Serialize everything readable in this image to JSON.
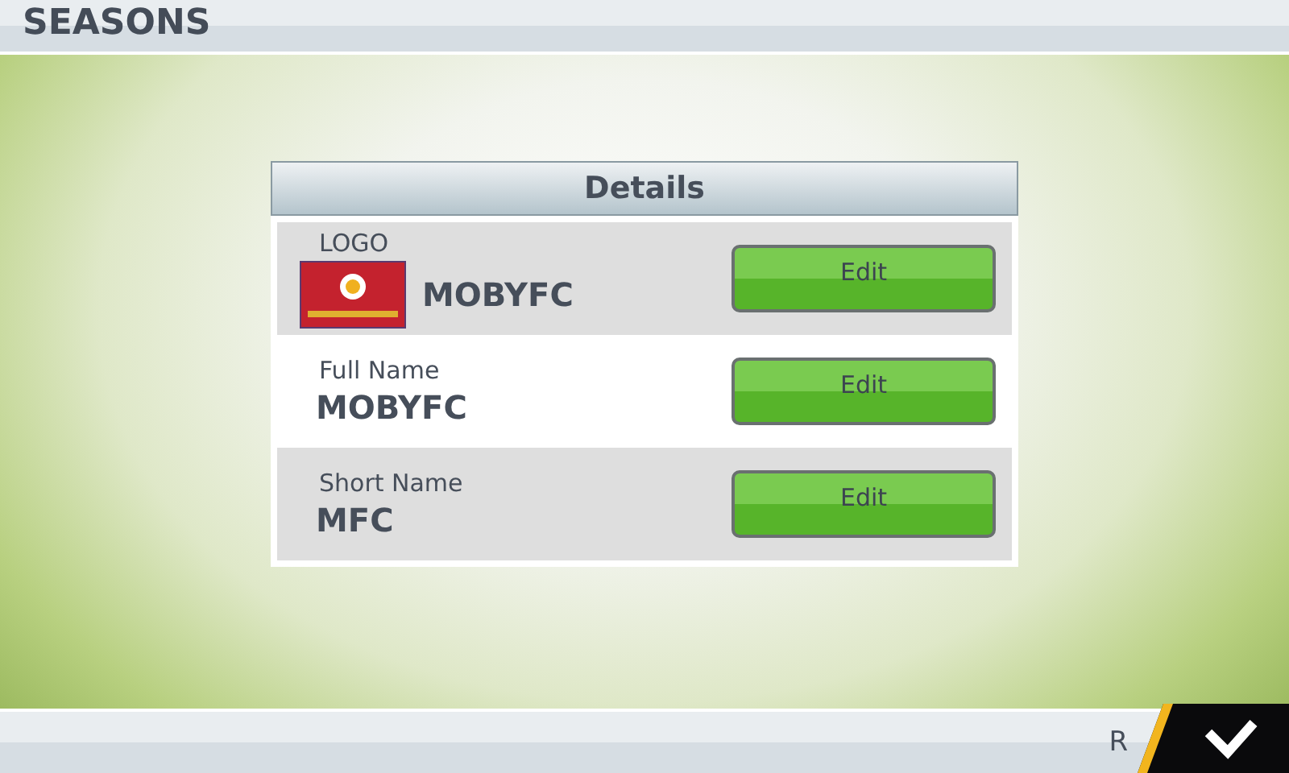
{
  "header": {
    "title": "SEASONS"
  },
  "panel": {
    "title": "Details",
    "rows": [
      {
        "kind": "logo",
        "label": "LOGO",
        "value": "MOBYFC",
        "button": "Edit"
      },
      {
        "kind": "text",
        "label": "Full Name",
        "value": "MOBYFC",
        "button": "Edit"
      },
      {
        "kind": "text",
        "label": "Short Name",
        "value": "MFC",
        "button": "Edit"
      }
    ]
  },
  "footer": {
    "label": "R"
  }
}
